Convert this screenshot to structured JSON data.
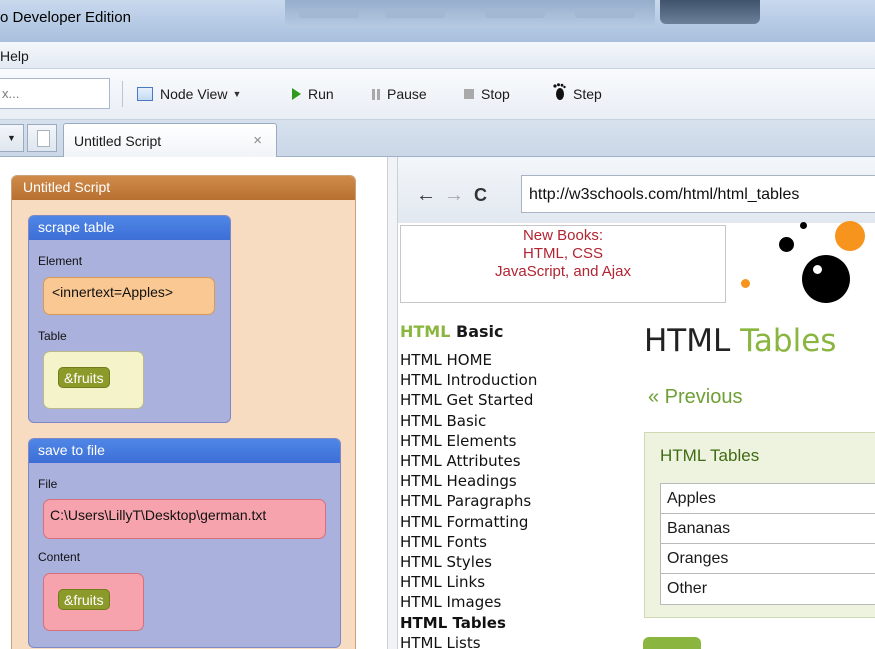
{
  "window": {
    "title": "o Developer Edition"
  },
  "menu": {
    "help": "Help"
  },
  "toolbar": {
    "search_placeholder": "x...",
    "node_view": "Node View",
    "run": "Run",
    "pause": "Pause",
    "stop": "Stop",
    "step": "Step"
  },
  "tabs": {
    "active": "Untitled Script",
    "close": "×"
  },
  "script": {
    "title": "Untitled Script",
    "blocks": [
      {
        "title": "scrape table",
        "field1_label": "Element",
        "field1_value": "<innertext=Apples>",
        "field2_label": "Table",
        "field2_value": "&fruits"
      },
      {
        "title": "save to file",
        "field1_label": "File",
        "field1_value": "C:\\Users\\LillyT\\Desktop\\german.txt",
        "field2_label": "Content",
        "field2_value": "&fruits"
      }
    ]
  },
  "browser": {
    "url": "http://w3schools.com/html/html_tables",
    "ad": {
      "line1": "New Books:",
      "line2": "HTML, CSS",
      "line3": "JavaScript, and Ajax"
    },
    "sidebar": {
      "title_prefix": "HTML",
      "title_suffix": "Basic",
      "links": [
        "HTML HOME",
        "HTML Introduction",
        "HTML Get Started",
        "HTML Basic",
        "HTML Elements",
        "HTML Attributes",
        "HTML Headings",
        "HTML Paragraphs",
        "HTML Formatting",
        "HTML Fonts",
        "HTML Styles",
        "HTML Links",
        "HTML Images",
        "HTML Tables",
        "HTML Lists"
      ]
    },
    "page": {
      "title_prefix": "HTML",
      "title_suffix": "Tables",
      "previous": "« Previous",
      "example_title": "HTML Tables",
      "rows": [
        "Apples",
        "Bananas",
        "Oranges",
        "Other"
      ]
    }
  },
  "colors": {
    "accent_green": "#8ab640",
    "block_blue": "#3d6fd6",
    "panel_orange": "#b8702f"
  }
}
